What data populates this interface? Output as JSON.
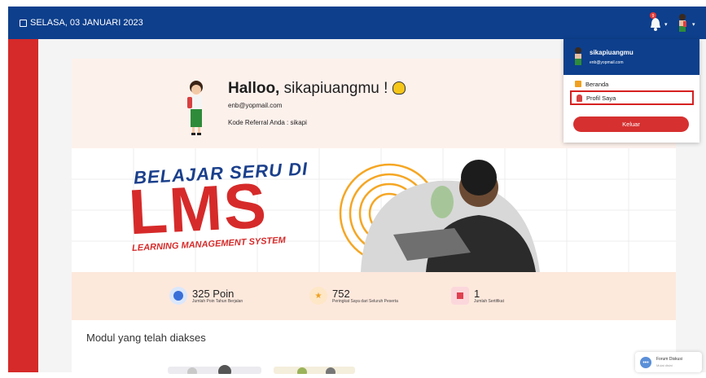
{
  "header": {
    "date": "SELASA, 03 JANUARI 2023",
    "notification_badge": "9"
  },
  "profile": {
    "greeting_bold": "Halloo,",
    "greeting_name": "sikapiuangmu !",
    "email": "enb@yopmail.com",
    "referral": "Kode Referral Anda : sikapi"
  },
  "banner": {
    "line1": "BELAJAR SERU DI",
    "line2": "LMS",
    "line3": "LEARNING MANAGEMENT SYSTEM"
  },
  "stats": [
    {
      "value": "325 Poin",
      "label": "Jumlah Poin Tahun Berjalan",
      "color": "#3b6fd8",
      "bg": "#dbe7fb"
    },
    {
      "value": "752",
      "label": "Peringkat Saya dari Seluruh Peserta",
      "color": "#f0a020",
      "bg": "#fde7c7"
    },
    {
      "value": "1",
      "label": "Jumlah Sertifikat",
      "color": "#e04050",
      "bg": "#fbd7dc"
    }
  ],
  "section": {
    "title": "Modul yang telah diakses"
  },
  "forum": {
    "title": "Forum Diskusi",
    "subtitle": "Mulai disini"
  },
  "dropdown": {
    "username": "sikapiuangmu",
    "email": "enb@yopmail.com",
    "items": [
      {
        "label": "Beranda",
        "icon": "home-icon"
      },
      {
        "label": "Profil Saya",
        "icon": "user-icon"
      }
    ],
    "logout": "Keluar"
  },
  "colors": {
    "primary": "#0d3f8c",
    "accent": "#d62a2a"
  }
}
